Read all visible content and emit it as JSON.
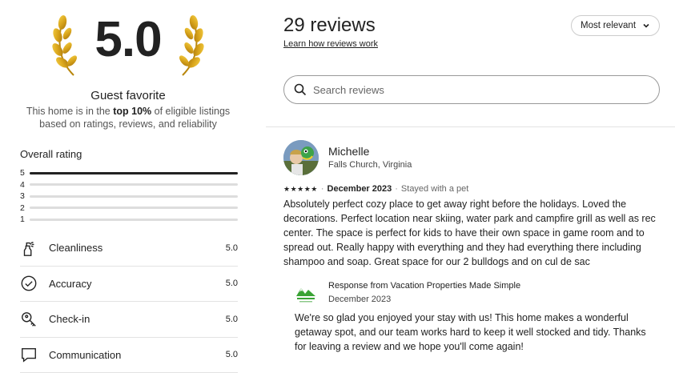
{
  "summary": {
    "score": "5.0",
    "badge_title": "Guest favorite",
    "badge_desc_prefix": "This home is in the ",
    "badge_desc_bold": "top 10%",
    "badge_desc_suffix": " of eligible listings based on ratings, reviews, and reliability",
    "laurel_color": "#d9a51c"
  },
  "overall": {
    "label": "Overall rating",
    "rows": [
      {
        "star": "5",
        "fraction": 1.0
      },
      {
        "star": "4",
        "fraction": 0.0
      },
      {
        "star": "3",
        "fraction": 0.0
      },
      {
        "star": "2",
        "fraction": 0.0
      },
      {
        "star": "1",
        "fraction": 0.0
      }
    ]
  },
  "categories": [
    {
      "label": "Cleanliness",
      "value": "5.0",
      "icon": "spray-bottle-icon"
    },
    {
      "label": "Accuracy",
      "value": "5.0",
      "icon": "check-circle-icon"
    },
    {
      "label": "Check-in",
      "value": "5.0",
      "icon": "key-icon"
    },
    {
      "label": "Communication",
      "value": "5.0",
      "icon": "message-bubble-icon"
    }
  ],
  "reviews_header": {
    "count_label": "29 reviews",
    "learn_link": "Learn how reviews work",
    "sort_label": "Most relevant"
  },
  "search": {
    "placeholder": "Search reviews"
  },
  "review": {
    "name": "Michelle",
    "location": "Falls Church, Virginia",
    "stars": "★★★★★",
    "rating": 5,
    "date": "December 2023",
    "stay_note": "Stayed with a pet",
    "text": "Absolutely perfect cozy place to get away right before the holidays. Loved the decorations. Perfect location near skiing, water park and campfire grill as well as rec center. The space is perfect for kids to have their own space in game room and to spread out. Really happy with everything and they had everything there including shampoo and soap. Great space for our 2 bulldogs and on cul de sac"
  },
  "response": {
    "title": "Response from Vacation Properties Made Simple",
    "date": "December 2023",
    "text": "We're so glad you enjoyed your stay with us! This home makes a wonderful getaway spot, and our team works hard to keep it well stocked and tidy. Thanks for leaving a review and we hope you'll come again!",
    "logo_color": "#3aa335"
  }
}
